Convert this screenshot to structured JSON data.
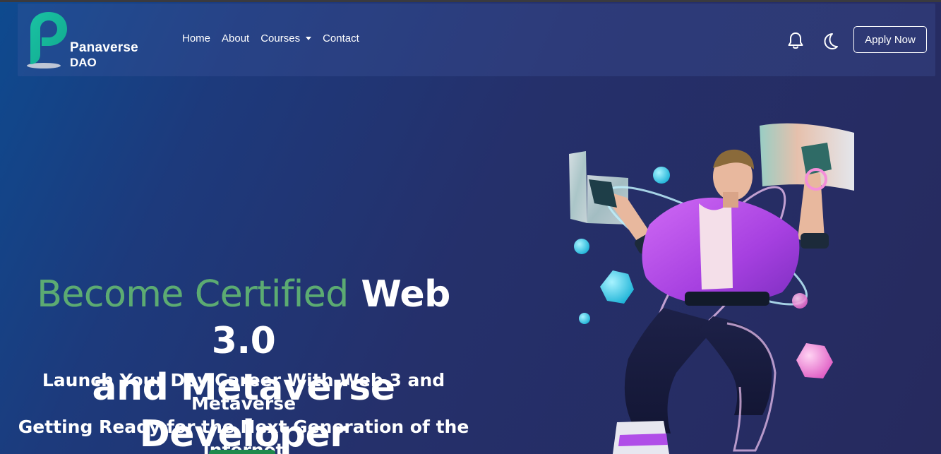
{
  "brand": {
    "name": "Panaverse",
    "sub": "DAO"
  },
  "nav": {
    "links": [
      {
        "label": "Home"
      },
      {
        "label": "About"
      },
      {
        "label": "Courses",
        "has_dropdown": true
      },
      {
        "label": "Contact"
      }
    ],
    "icons": [
      "bell-icon",
      "moon-icon"
    ],
    "apply_label": "Apply Now"
  },
  "hero": {
    "title_accent": "Become Certified",
    "title_rest_line1": "Web 3.0",
    "title_line2": "and Metaverse Developer",
    "subtitle_line1": "Launch Your Dev Career With Web 3 and Metaverse",
    "subtitle_line2": "Getting Ready for the Next Generation of the",
    "subtitle_line3": "Internet"
  },
  "colors": {
    "accent_green": "#5cab72",
    "brand_teal": "#1ec8a0",
    "cta_green": "#1f8a4c",
    "illustration_purple": "#b04ee8",
    "illustration_cyan": "#3fd6f0"
  }
}
